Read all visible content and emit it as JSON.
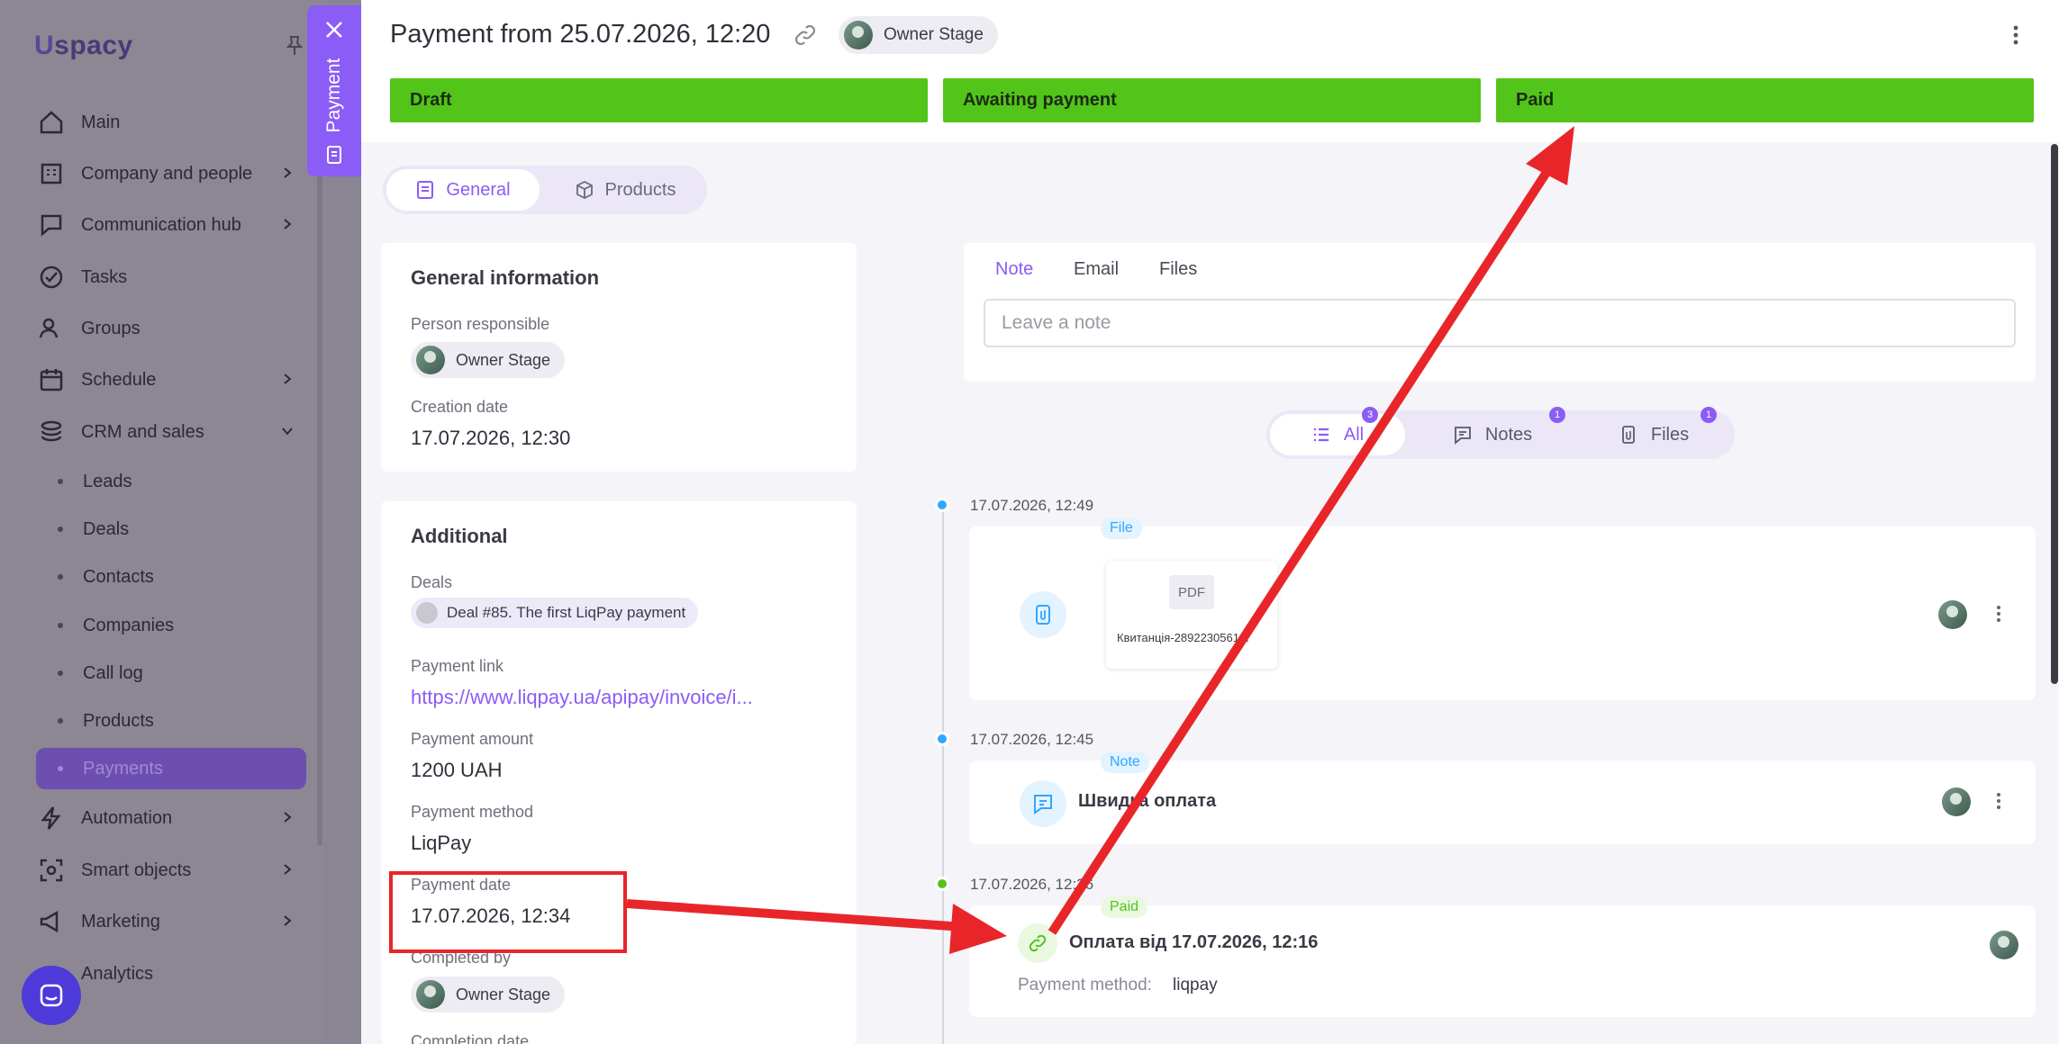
{
  "sidebar": {
    "logo": "spacy",
    "items": [
      {
        "label": "Main",
        "icon": "home-icon"
      },
      {
        "label": "Company and people",
        "icon": "building-icon"
      },
      {
        "label": "Communication hub",
        "icon": "chat-edit-icon"
      },
      {
        "label": "Tasks",
        "icon": "check-circle-icon"
      },
      {
        "label": "Groups",
        "icon": "users-icon"
      },
      {
        "label": "Schedule",
        "icon": "calendar-icon"
      },
      {
        "label": "CRM and sales",
        "icon": "stack-icon"
      }
    ],
    "crm_sub": [
      "Leads",
      "Deals",
      "Contacts",
      "Companies",
      "Call log",
      "Products",
      "Payments"
    ],
    "items_after": [
      {
        "label": "Automation",
        "icon": "bolt-icon"
      },
      {
        "label": "Smart objects",
        "icon": "smart-object-icon"
      },
      {
        "label": "Marketing",
        "icon": "megaphone-icon"
      },
      {
        "label": "Analytics",
        "icon": "chart-icon"
      }
    ]
  },
  "side_tab": {
    "label": "Payment"
  },
  "header": {
    "title": "Payment from 25.07.2026, 12:20",
    "owner": "Owner Stage"
  },
  "stages": [
    "Draft",
    "Awaiting payment",
    "Paid"
  ],
  "colors": {
    "accent": "#8b5cf6",
    "stage_green": "#52c41a",
    "highlight_red": "#e8262a"
  },
  "tabs": {
    "general": "General",
    "products": "Products"
  },
  "general_info": {
    "title": "General information",
    "person_label": "Person responsible",
    "person": "Owner Stage",
    "creation_label": "Creation date",
    "creation_value": "17.07.2026, 12:30"
  },
  "additional": {
    "title": "Additional",
    "deals_label": "Deals",
    "deal": "Deal #85. The first LiqPay payment",
    "link_label": "Payment link",
    "link": "https://www.liqpay.ua/apipay/invoice/i...",
    "amount_label": "Payment amount",
    "amount": "1200 UAH",
    "method_label": "Payment method",
    "method": "LiqPay",
    "date_label": "Payment date",
    "date": "17.07.2026, 12:34",
    "completed_label": "Completed by",
    "completed_by": "Owner Stage",
    "completion_label": "Completion date"
  },
  "composer": {
    "tabs": [
      "Note",
      "Email",
      "Files"
    ],
    "placeholder": "Leave a note"
  },
  "feed_filter": {
    "all": "All",
    "all_count": "3",
    "notes": "Notes",
    "notes_count": "1",
    "files": "Files",
    "files_count": "1"
  },
  "timeline": [
    {
      "time": "17.07.2026, 12:49",
      "tag": "File",
      "pdf": "PDF",
      "filename": "Квитанція-2892230561..."
    },
    {
      "time": "17.07.2026, 12:45",
      "tag": "Note",
      "title": "Швидка оплата"
    },
    {
      "time": "17.07.2026, 12:36",
      "tag": "Paid",
      "title": "Оплата від 17.07.2026, 12:16",
      "method_label": "Payment method:",
      "method": "liqpay"
    }
  ]
}
